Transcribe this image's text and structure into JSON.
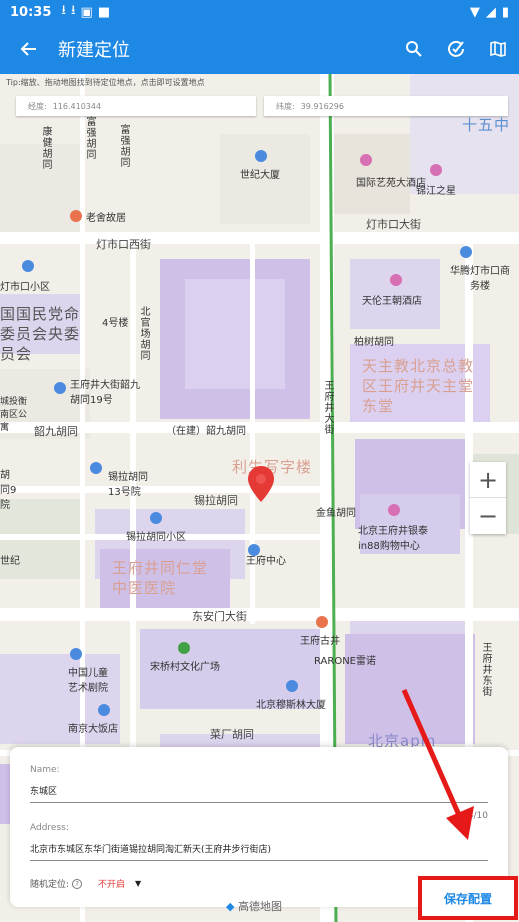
{
  "status_bar": {
    "time": "10:35"
  },
  "app_bar": {
    "title": "新建定位",
    "icons": [
      "back-arrow-icon",
      "search-icon",
      "edit-check-icon",
      "map-icon"
    ]
  },
  "map": {
    "tip": "Tip:缩放、拖动地图找到待定位地点，点击即可设置地点",
    "lon_label": "经度:",
    "lon_value": "116.410344",
    "lat_label": "纬度:",
    "lat_value": "39.916296",
    "labels": {
      "kangjian": "康健胡同",
      "fuqiang1": "富强胡同",
      "fuqiang2": "富强胡同",
      "shiji": "世纪大厦",
      "guoji_yiyuan": "国际艺苑大酒店",
      "jinjiang": "锦江之星",
      "laoshe": "老舍故居",
      "dengshikou_w": "灯市口西街",
      "dengshikou_d": "灯市口大街",
      "dengshikou_xq": "灯市口小区",
      "huamao": "华腾灯市口商务楼",
      "tianlun": "天伦王朝酒店",
      "minzhu": "国国民党命委员会央委员会",
      "hao4": "4号楼",
      "beiguan": "北官场胡同",
      "baishu": "柏树胡同",
      "tianzhujiao": "天主教北京总教区王府井天主堂东堂",
      "wangfujing_dajie": "王府井大街",
      "wfj_shao": "王府井大街韶九胡同19号",
      "chengtou": "城投衡南区公寓",
      "shaojiu": "韶九胡同",
      "zaijian": "（在建）韶九胡同",
      "lisheng": "利生写字楼",
      "xila13": "锡拉胡同13号院",
      "hutong9": "胡同9院",
      "xila": "锡拉胡同",
      "jinyu": "金鱼胡同",
      "wfj_yintai": "北京王府井银泰in88购物中心",
      "shiji2": "世纪",
      "xila_xq": "锡拉胡同小区",
      "wfj_zx": "王府中心",
      "tongren": "王府井同仁堂中医医院",
      "dongan": "东安门大街",
      "wfj_guji": "王府古井",
      "rarone": "RARONE雷诺",
      "wfj_dongjie": "王府井东街",
      "songqiao": "宋桥村文化广场",
      "ertong": "中国儿童艺术剧院",
      "mushi": "北京穆斯林大厦",
      "nanjing": "南京大饭店",
      "caichang": "菜厂胡同",
      "beijing_apm": "北京apm",
      "shiwu": "十五中"
    }
  },
  "panel": {
    "name_label": "Name:",
    "name_value": "东城区",
    "address_label": "Address:",
    "address_value": "北京市东城区东华门街道锡拉胡同淘汇新天(王府井步行街店)",
    "counter": "3/10",
    "random_label": "随机定位:",
    "random_value": "不开启",
    "save_label": "保存配置",
    "logo": "高德地图"
  }
}
